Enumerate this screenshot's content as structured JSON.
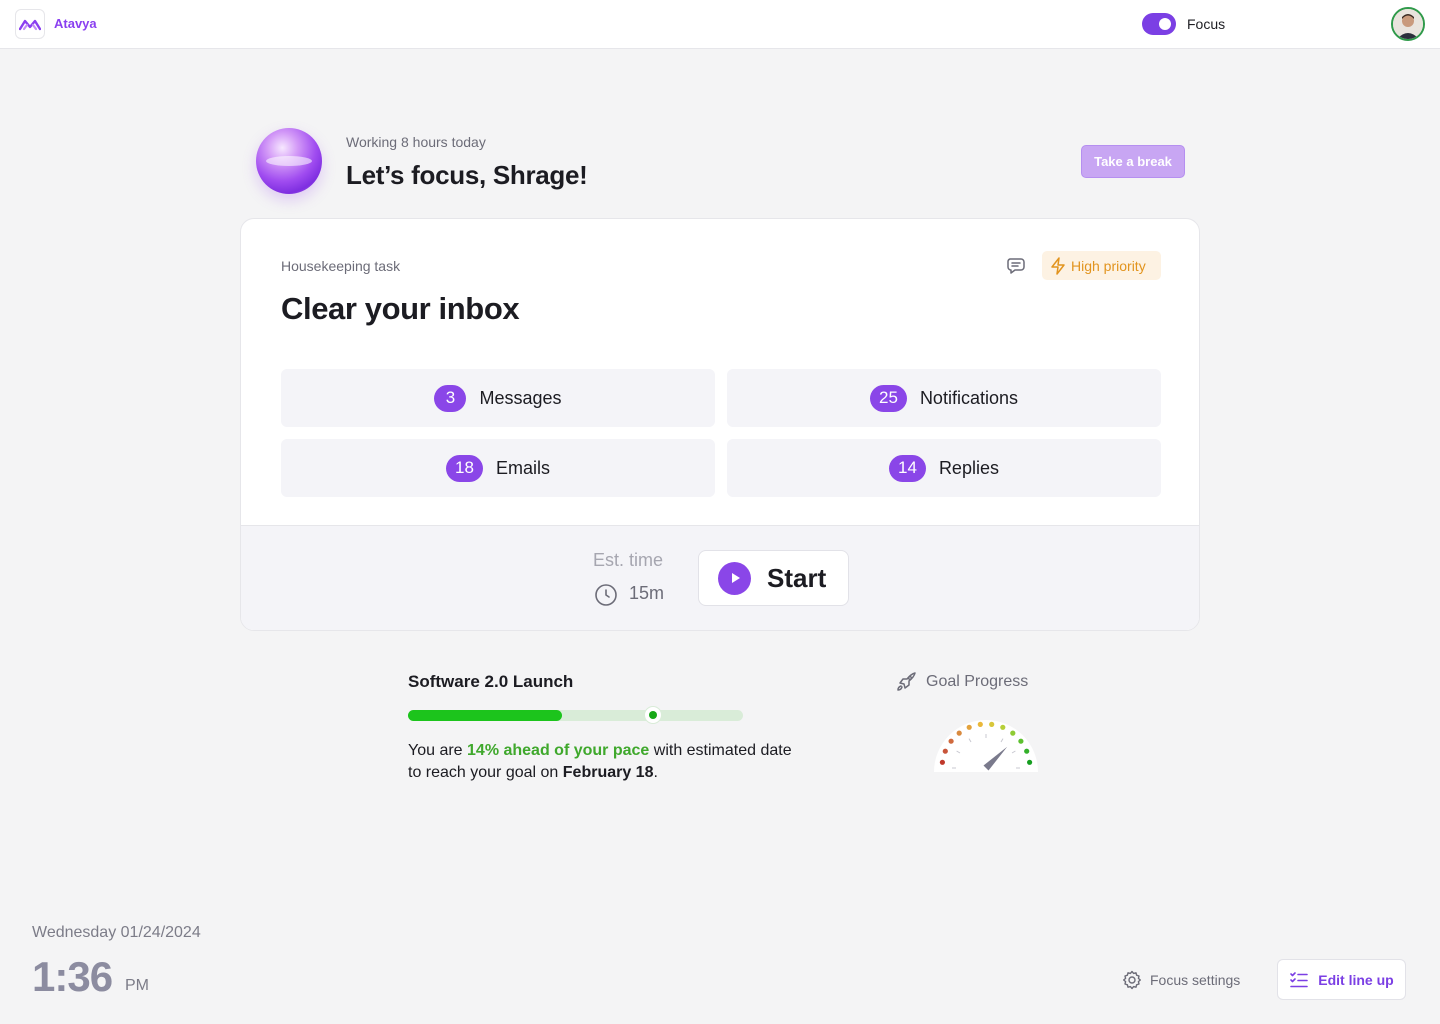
{
  "app": {
    "name": "Atavya"
  },
  "topbar": {
    "focus_label": "Focus",
    "focus_on": true
  },
  "header": {
    "working": "Working 8 hours today",
    "greeting": "Let’s focus, Shrage!",
    "break_button": "Take a break"
  },
  "task": {
    "type": "Housekeeping task",
    "title": "Clear your inbox",
    "priority": "High priority",
    "stats": [
      {
        "count": "3",
        "label": "Messages"
      },
      {
        "count": "25",
        "label": "Notifications"
      },
      {
        "count": "18",
        "label": "Emails"
      },
      {
        "count": "14",
        "label": "Replies"
      }
    ],
    "est_label": "Est. time",
    "est_value": "15m",
    "start_label": "Start"
  },
  "goal": {
    "title": "Software 2.0 Launch",
    "progress_fraction": 0.46,
    "pace_marker_fraction": 0.73,
    "text_prefix": "You are ",
    "pace": "14% ahead of your pace",
    "text_middle": " with estimated date to reach your goal on ",
    "date": "February 18",
    "text_suffix": ".",
    "progress_label": "Goal Progress",
    "gauge_level_fraction": 0.75
  },
  "footer": {
    "date": "Wednesday 01/24/2024",
    "time": "1:36",
    "ampm": "PM",
    "settings_label": "Focus settings",
    "edit_label": "Edit line up"
  },
  "colors": {
    "accent": "#8a46e8",
    "priority": "#e2941e",
    "progress": "#1cc41c",
    "pace_text": "#3fa82c"
  },
  "icons": [
    "atavya-logo",
    "avatar",
    "chat-icon",
    "lightning-icon",
    "clock-icon",
    "play-icon",
    "rocket-icon",
    "gauge-icon",
    "gear-icon",
    "list-check-icon"
  ]
}
